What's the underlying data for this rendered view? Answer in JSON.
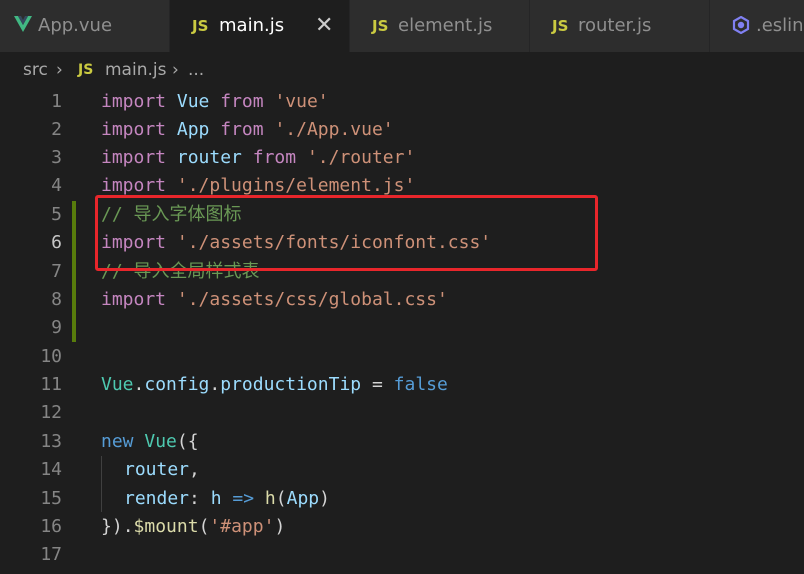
{
  "tabs": [
    {
      "label": "App.vue",
      "icon": "vue-icon",
      "active": false
    },
    {
      "label": "main.js",
      "icon": "js-icon",
      "active": true
    },
    {
      "label": "element.js",
      "icon": "js-icon",
      "active": false
    },
    {
      "label": "router.js",
      "icon": "js-icon",
      "active": false
    },
    {
      "label": ".eslint",
      "icon": "eslint-icon",
      "active": false
    }
  ],
  "tab_icon_text": "JS",
  "close_glyph": "✕",
  "breadcrumb": {
    "folder": "src",
    "sep": "›",
    "file_icon": "JS",
    "file": "main.js",
    "ellipsis": "..."
  },
  "line_numbers": [
    "1",
    "2",
    "3",
    "4",
    "5",
    "6",
    "7",
    "8",
    "9",
    "10",
    "11",
    "12",
    "13",
    "14",
    "15",
    "16",
    "17"
  ],
  "code": {
    "l1": {
      "k": "import",
      "a": " ",
      "b": "Vue",
      "c": " ",
      "d": "from",
      "e": " ",
      "f": "'vue'"
    },
    "l2": {
      "k": "import",
      "a": " ",
      "b": "App",
      "c": " ",
      "d": "from",
      "e": " ",
      "f": "'./App.vue'"
    },
    "l3": {
      "k": "import",
      "a": " ",
      "b": "router",
      "c": " ",
      "d": "from",
      "e": " ",
      "f": "'./router'"
    },
    "l4": {
      "k": "import",
      "a": " ",
      "f": "'./plugins/element.js'"
    },
    "l5": {
      "c": "// 导入字体图标"
    },
    "l6": {
      "k": "import",
      "a": " ",
      "f": "'./assets/fonts/iconfont.css'"
    },
    "l7": {
      "c": "// 导入全局样式表"
    },
    "l8": {
      "k": "import",
      "a": " ",
      "f": "'./assets/css/global.css'"
    },
    "l11": {
      "a": "Vue",
      "b": ".",
      "c": "config",
      "d": ".",
      "e": "productionTip",
      "f": " = ",
      "g": "false"
    },
    "l13": {
      "a": "new",
      "b": " ",
      "c": "Vue",
      "d": "({"
    },
    "l14": {
      "a": "router",
      "b": ","
    },
    "l15": {
      "a": "render",
      "b": ": ",
      "c": "h",
      "d": " => ",
      "e": "h",
      "f": "(",
      "g": "App",
      "h": ")"
    },
    "l16": {
      "a": "})",
      "b": ".",
      "c": "$mount",
      "d": "(",
      "e": "'#app'",
      "f": ")"
    }
  },
  "colors": {
    "highlight_box": "#e8262b",
    "modified_bar": "#587c0c",
    "js_icon": "#cbcb41"
  }
}
